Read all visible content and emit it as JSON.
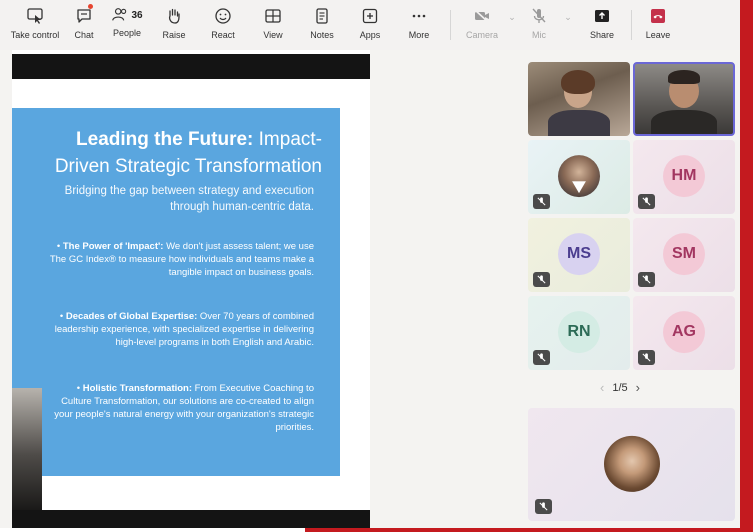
{
  "toolbar": {
    "take_control": "Take control",
    "chat": "Chat",
    "people": "People",
    "people_count": "36",
    "raise": "Raise",
    "react": "React",
    "view": "View",
    "notes": "Notes",
    "apps": "Apps",
    "more": "More",
    "camera": "Camera",
    "mic": "Mic",
    "share": "Share",
    "leave": "Leave"
  },
  "slide": {
    "title_bold": "Leading the Future:",
    "title_rest": " Impact-",
    "title_line2": "Driven Strategic Transformation",
    "subtitle": "Bridging the gap between strategy and execution through human-centric data.",
    "bullets": [
      {
        "heading": "The Power of 'Impact':",
        "text": " We don't just assess talent; we use The GC Index® to measure how individuals and teams make a tangible impact on business goals."
      },
      {
        "heading": "Decades of Global Expertise:",
        "text": " Over 70 years of combined leadership experience, with specialized expertise in delivering high-level programs in both English and Arabic."
      },
      {
        "heading": "Holistic Transformation:",
        "text": " From Executive Coaching to Culture Transformation, our solutions are co-created to align your people's natural energy with your organization's strategic priorities."
      }
    ]
  },
  "participants": {
    "hm": "HM",
    "ms": "MS",
    "sm": "SM",
    "rn": "RN",
    "ag": "AG"
  },
  "pager": {
    "label": "1/5"
  },
  "colors": {
    "accent_red": "#c41a1f",
    "slide_blue": "#5aa6df",
    "active_speaker": "#6b67d6",
    "leave_red": "#c4314b"
  }
}
